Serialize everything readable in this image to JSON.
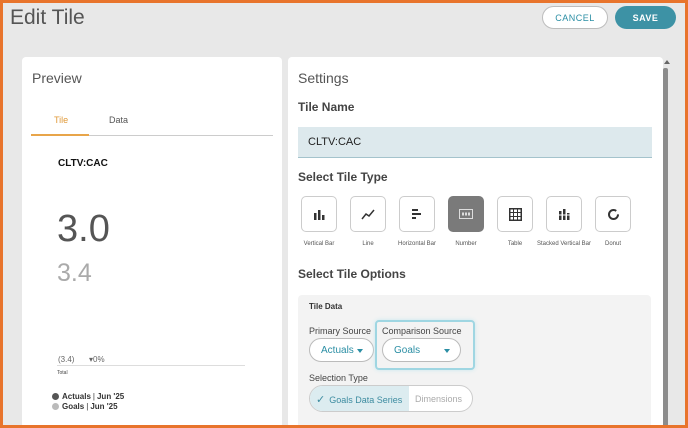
{
  "header": {
    "title": "Edit Tile",
    "cancel_label": "CANCEL",
    "save_label": "SAVE"
  },
  "preview": {
    "title": "Preview",
    "tabs": [
      {
        "label": "Tile",
        "active": true
      },
      {
        "label": "Data",
        "active": false
      }
    ],
    "tile_name": "CLTV:CAC",
    "value": "3.0",
    "comparison_value": "3.4",
    "difference": "(3.4)",
    "percent_change": "▾0%",
    "total_label": "Total",
    "legend": [
      {
        "name": "Actuals",
        "period": "Jun '25",
        "color": "#555555"
      },
      {
        "name": "Goals",
        "period": "Jun '25",
        "color": "#bbbbbb"
      }
    ]
  },
  "settings": {
    "title": "Settings",
    "tile_name_heading": "Tile Name",
    "tile_name_value": "CLTV:CAC",
    "tile_type_heading": "Select Tile Type",
    "tile_types": [
      {
        "label": "Vertical Bar",
        "icon": "vertical-bar-icon",
        "selected": false
      },
      {
        "label": "Line",
        "icon": "line-chart-icon",
        "selected": false
      },
      {
        "label": "Horizontal Bar",
        "icon": "horizontal-bar-icon",
        "selected": false
      },
      {
        "label": "Number",
        "icon": "number-icon",
        "selected": true
      },
      {
        "label": "Table",
        "icon": "table-icon",
        "selected": false
      },
      {
        "label": "Stacked Vertical Bar",
        "icon": "stacked-bar-icon",
        "selected": false
      },
      {
        "label": "Donut",
        "icon": "donut-icon",
        "selected": false
      }
    ],
    "tile_options_heading": "Select Tile Options",
    "tile_data_heading": "Tile Data",
    "primary_source_label": "Primary Source",
    "primary_source_value": "Actuals",
    "comparison_source_label": "Comparison Source",
    "comparison_source_value": "Goals",
    "selection_type_label": "Selection Type",
    "selection_options": [
      {
        "label": "Goals Data Series",
        "selected": true
      },
      {
        "label": "Dimensions",
        "selected": false
      }
    ]
  },
  "colors": {
    "accent": "#3d92a5",
    "tab_active": "#e8a54a",
    "frame": "#e8742c"
  }
}
